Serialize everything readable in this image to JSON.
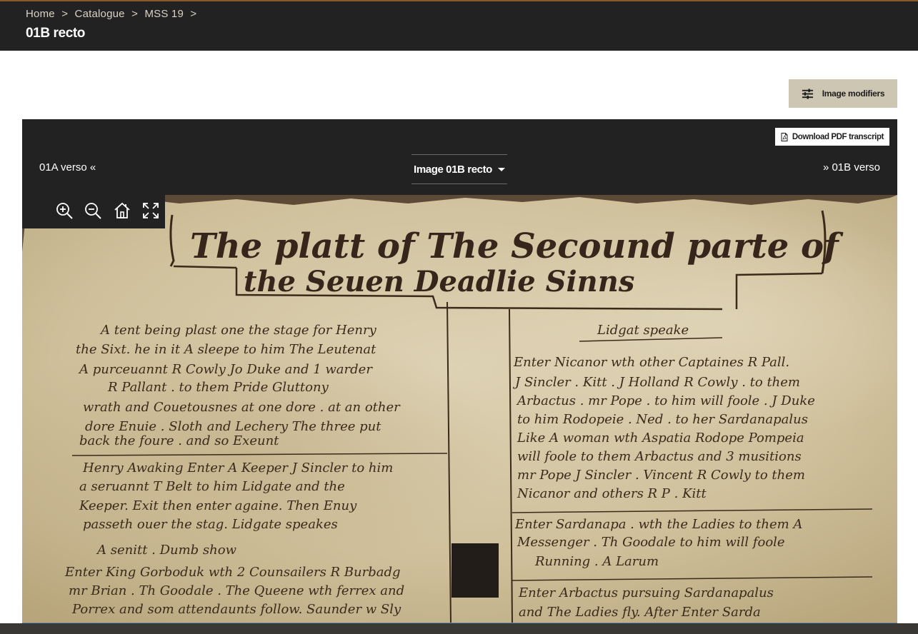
{
  "breadcrumb": {
    "items": [
      "Home",
      "Catalogue",
      "MSS 19"
    ],
    "separator": ">"
  },
  "page": {
    "title": "01B recto"
  },
  "modifiers_button": {
    "label": "Image modifiers",
    "icon": "sliders-icon"
  },
  "viewer": {
    "pdf_button": {
      "label": "Download PDF transcript",
      "icon": "pdf-file-icon"
    },
    "prev": {
      "label": "01A verso «"
    },
    "next": {
      "label": "» 01B verso"
    },
    "image_select": {
      "selected": "Image 01B recto"
    },
    "toolbar": {
      "zoom_in_icon": "zoom-in-icon",
      "zoom_out_icon": "zoom-out-icon",
      "home_icon": "home-icon",
      "fullscreen_icon": "fullscreen-icon"
    },
    "manuscript": {
      "heading_line1": "The platt of The Secound parte of",
      "heading_line2": "the Seuen Deadlie Sinns",
      "left_column": [
        "A tent being plast one the stage for Henry",
        "the Sixt. he in it A sleepe to him The Leutenat",
        "A purceuannt R Cowly Jo Duke and 1 warder",
        "R Pallant . to them Pride Gluttony",
        "wrath and Couetousnes at one dore . at an other",
        "dore Enuie . Sloth and Lechery The three put",
        "back the foure . and so Exeunt",
        "Henry Awaking Enter A Keeper J Sincler to him",
        "a seruannt T Belt to him Lidgate and the",
        "Keeper. Exit then enter againe. Then Enuy",
        "passeth ouer the stag. Lidgate speakes",
        "A senitt . Dumb show",
        "Enter King Gorboduk wth 2 Counsailers R Burbadg",
        "mr Brian . Th Goodale . The Queene wth ferrex and",
        "Porrex and som attendaunts follow. Saunder w Sly"
      ],
      "right_column": [
        "Lidgat speake",
        "Enter Nicanor wth other Captaines R Pall.",
        "J Sincler . Kitt . J Holland R Cowly . to them",
        "Arbactus . mr Pope . to him will foole . J Duke",
        "to him Rodopeie . Ned . to her Sardanapalus",
        "Like A woman wth Aspatia Rodope Pompeia",
        "will foole to them Arbactus and 3 musitions",
        "mr Pope J Sincler . Vincent R Cowly to them",
        "Nicanor and others R P . Kitt",
        "Enter Sardanapa . wth the Ladies to them A",
        "Messenger . Th Goodale to him will foole",
        "Running . A Larum",
        "Enter Arbactus pursuing Sardanapalus",
        "and The Ladies fly. After Enter Sarda"
      ]
    }
  },
  "colors": {
    "header_bg": "#222222",
    "accent_border": "#8a5a2e",
    "button_bg": "#cdc6b3",
    "parchment": "#d6c9a8",
    "ink": "#3b2a1a"
  }
}
